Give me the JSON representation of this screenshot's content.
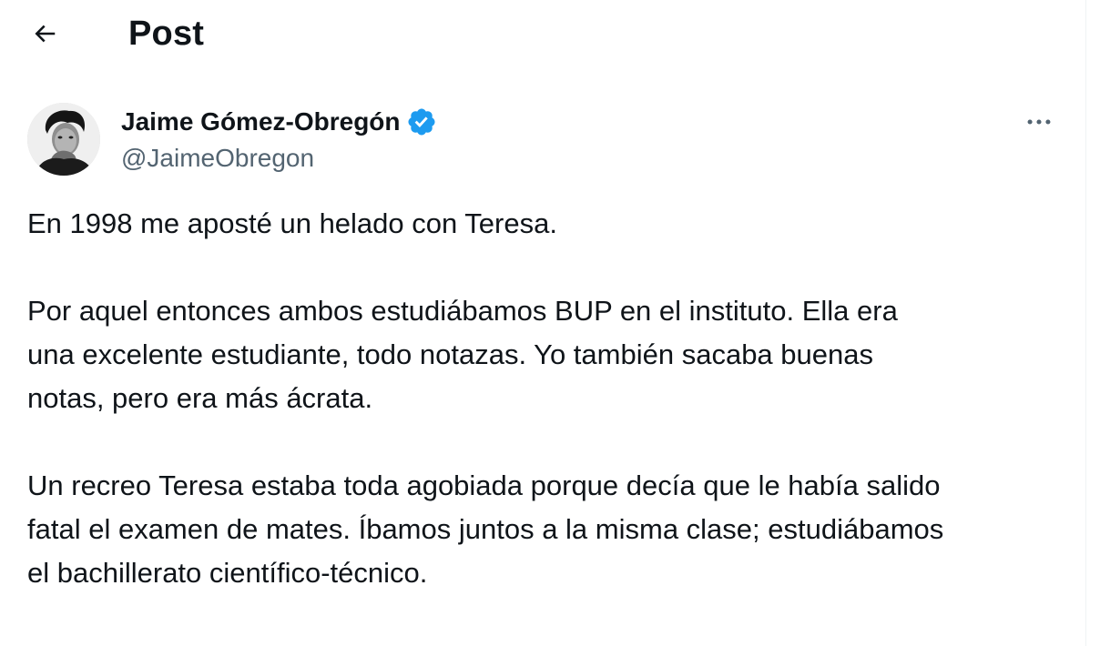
{
  "header": {
    "title": "Post"
  },
  "author": {
    "name": "Jaime Gómez-Obregón",
    "handle": "@JaimeObregon",
    "verified": true,
    "verified_color": "#1d9bf0"
  },
  "post": {
    "paragraphs": [
      "En 1998 me aposté un helado con Teresa.",
      "Por aquel entonces ambos estudiábamos BUP en el instituto. Ella era\nuna excelente estudiante, todo notazas. Yo también sacaba buenas\nnotas, pero era más ácrata.",
      "Un recreo Teresa estaba toda agobiada porque decía que le había salido\nfatal el examen de mates. Íbamos juntos a la misma clase; estudiábamos\nel bachillerato científico-técnico."
    ]
  },
  "icons": {
    "back": "arrow-left-icon",
    "verified": "verified-badge-icon",
    "more": "more-horizontal-icon"
  },
  "colors": {
    "text_primary": "#0f1419",
    "text_secondary": "#536471",
    "border": "#eff3f4"
  }
}
